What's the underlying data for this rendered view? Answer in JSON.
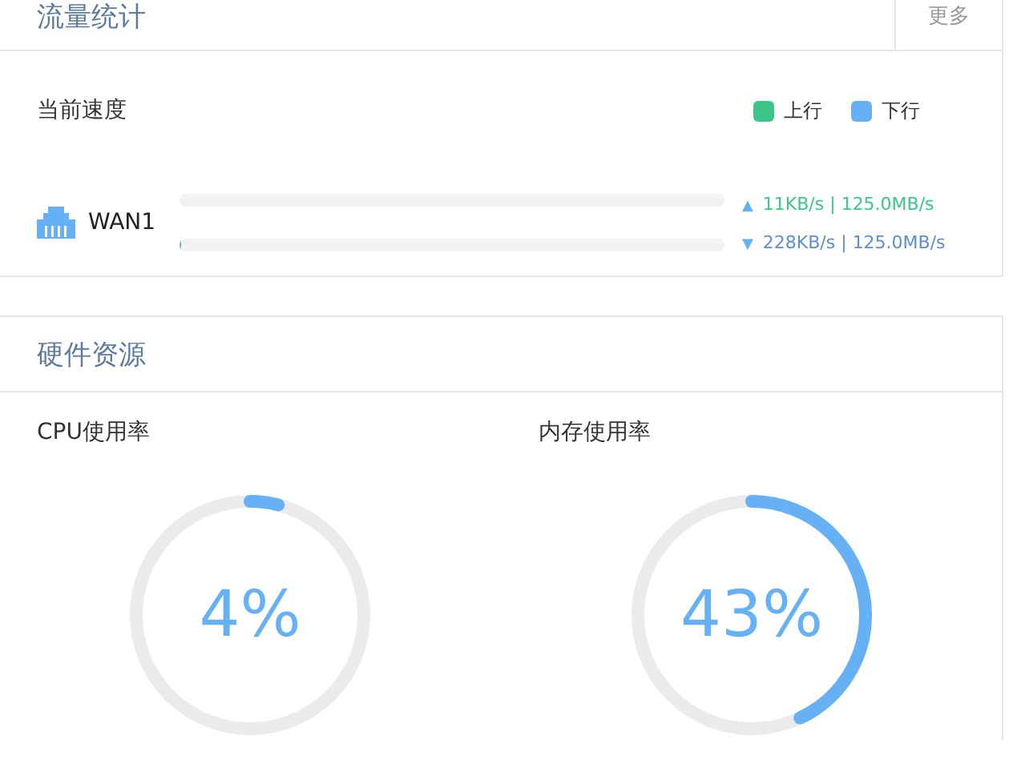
{
  "traffic": {
    "title": "流量统计",
    "more": "更多",
    "speed_label": "当前速度",
    "legend": [
      {
        "label": "上行",
        "color": "#3cc68a"
      },
      {
        "label": "下行",
        "color": "#66b1f5"
      }
    ],
    "interfaces": [
      {
        "name": "WAN1",
        "up": {
          "arrow": "▲",
          "reading": "11KB/s | 125.0MB/s",
          "level": 0.0001
        },
        "down": {
          "arrow": "▼",
          "reading": "228KB/s | 125.0MB/s",
          "level": 0.0018
        }
      }
    ]
  },
  "hardware": {
    "title": "硬件资源",
    "gauges": [
      {
        "label": "CPU使用率",
        "value": "4%"
      },
      {
        "label": "内存使用率",
        "value": "43%"
      }
    ]
  }
}
